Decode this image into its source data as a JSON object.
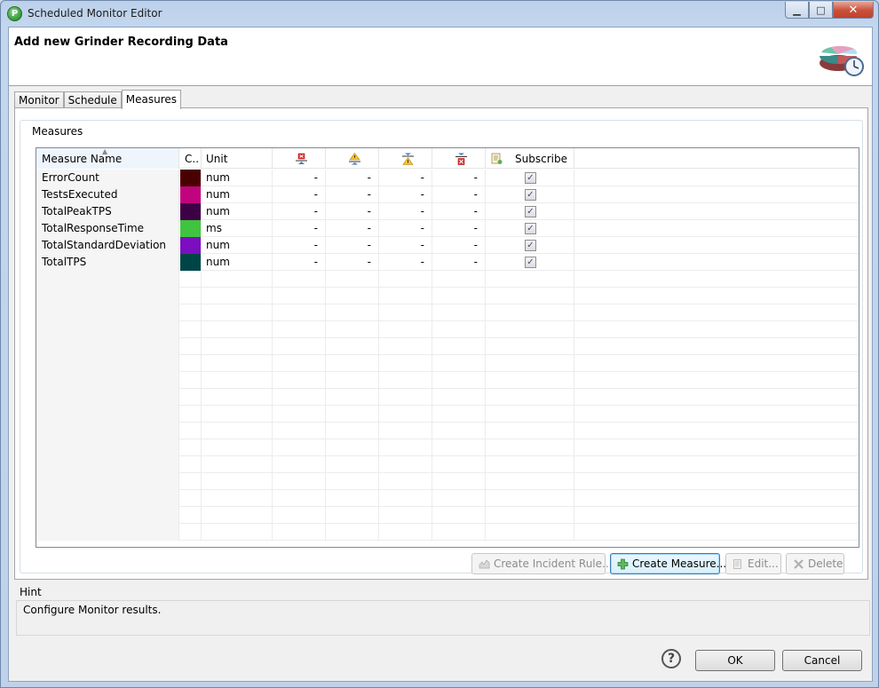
{
  "window": {
    "title": "Scheduled Monitor Editor",
    "app_icon_letter": "P"
  },
  "header": {
    "title": "Add new Grinder Recording Data"
  },
  "tabs": [
    {
      "label": "Monitor",
      "active": false
    },
    {
      "label": "Schedule",
      "active": false
    },
    {
      "label": "Measures",
      "active": true
    }
  ],
  "measures_group": {
    "label": "Measures"
  },
  "table": {
    "columns": {
      "name": "Measure Name",
      "color": "C..",
      "unit": "Unit",
      "subscribe": "Subscribe"
    },
    "column_icons": [
      "upper-severe-threshold-icon",
      "upper-warning-threshold-icon",
      "lower-warning-threshold-icon",
      "lower-severe-threshold-icon",
      "subscribe-icon"
    ],
    "rows": [
      {
        "name": "ErrorCount",
        "color": "#4a0000",
        "unit": "num",
        "v1": "-",
        "v2": "-",
        "v3": "-",
        "v4": "-",
        "subscribed": "✓"
      },
      {
        "name": "TestsExecuted",
        "color": "#c0047e",
        "unit": "num",
        "v1": "-",
        "v2": "-",
        "v3": "-",
        "v4": "-",
        "subscribed": "✓"
      },
      {
        "name": "TotalPeakTPS",
        "color": "#3e0044",
        "unit": "num",
        "v1": "-",
        "v2": "-",
        "v3": "-",
        "v4": "-",
        "subscribed": "✓"
      },
      {
        "name": "TotalResponseTime",
        "color": "#3fc43f",
        "unit": "ms",
        "v1": "-",
        "v2": "-",
        "v3": "-",
        "v4": "-",
        "subscribed": "✓"
      },
      {
        "name": "TotalStandardDeviation",
        "color": "#7c0ec0",
        "unit": "num",
        "v1": "-",
        "v2": "-",
        "v3": "-",
        "v4": "-",
        "subscribed": "✓"
      },
      {
        "name": "TotalTPS",
        "color": "#004545",
        "unit": "num",
        "v1": "-",
        "v2": "-",
        "v3": "-",
        "v4": "-",
        "subscribed": "✓"
      }
    ]
  },
  "buttons": {
    "create_incident_rule": "Create Incident Rule...",
    "create_measure": "Create Measure...",
    "edit": "Edit...",
    "delete": "Delete"
  },
  "hint": {
    "label": "Hint",
    "text": "Configure Monitor results."
  },
  "dialog": {
    "help_glyph": "?",
    "ok": "OK",
    "cancel": "Cancel"
  },
  "window_controls": {
    "minimize": "▁",
    "maximize": "□",
    "close": "✕"
  }
}
